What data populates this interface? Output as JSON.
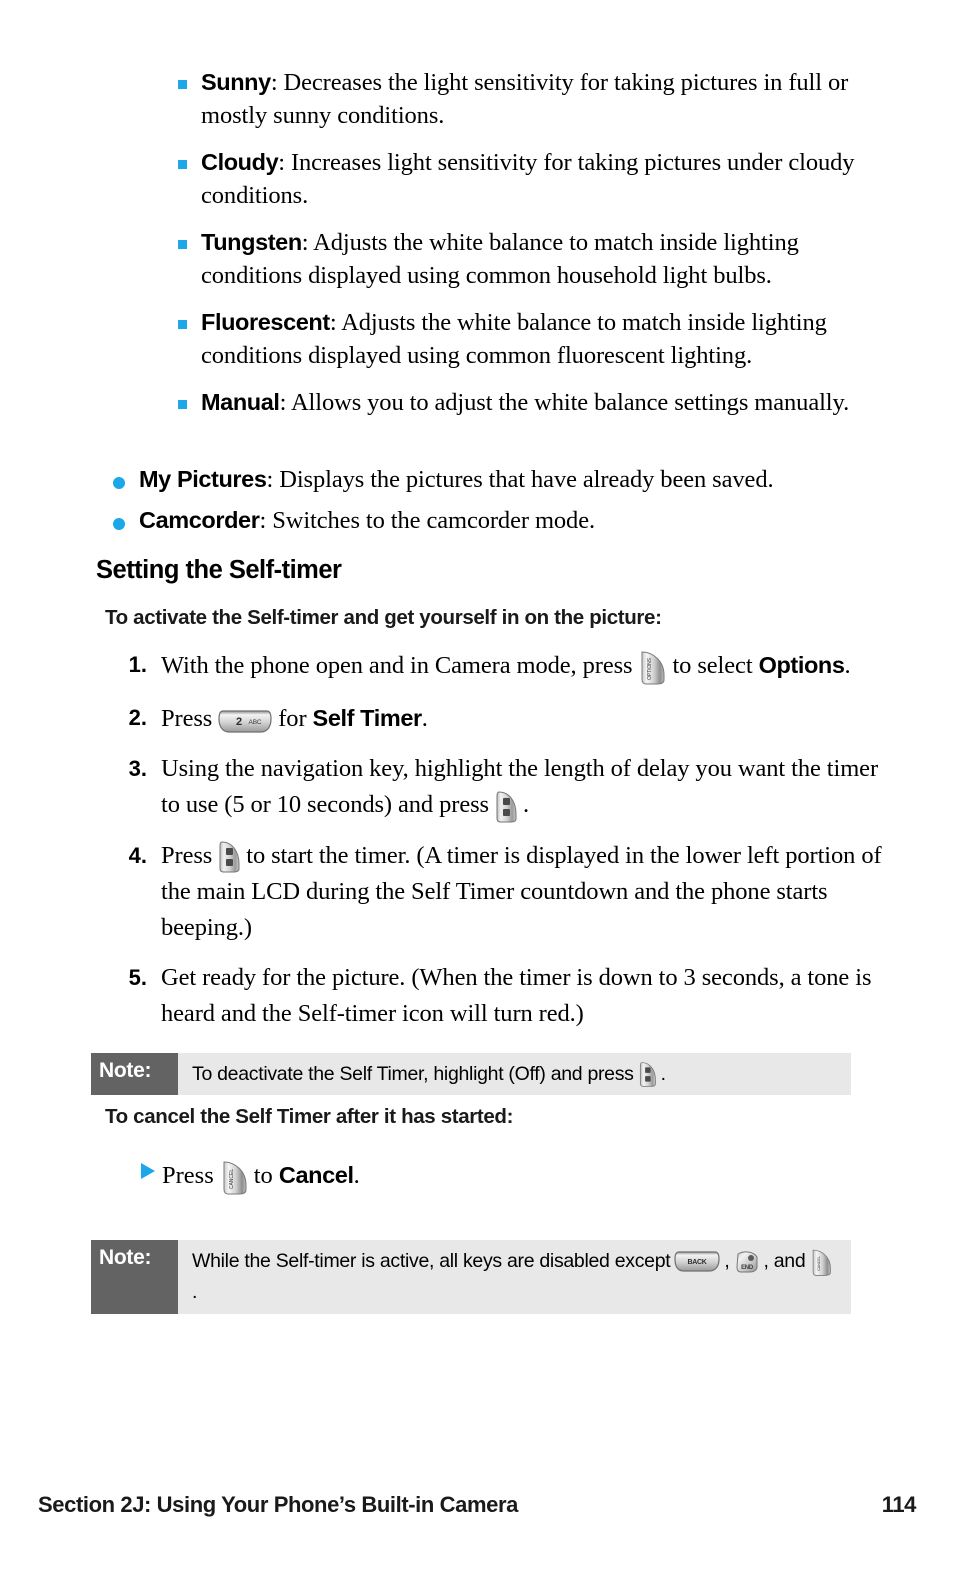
{
  "document": {
    "page_number": "114",
    "footer_section": "Section 2J: Using Your Phone’s Built-in Camera",
    "accent_color": "#1BA7E8",
    "note_label_bg": "#636363",
    "note_body_bg": "#e8e8e8"
  },
  "white_balance_options": [
    {
      "term": "Sunny",
      "description": ": Decreases the light sensitivity for taking pictures in full or mostly sunny conditions."
    },
    {
      "term": "Cloudy",
      "description": ": Increases light sensitivity for taking pictures under cloudy conditions."
    },
    {
      "term": "Tungsten",
      "description": ": Adjusts the white balance to match inside lighting conditions displayed using common household light bulbs."
    },
    {
      "term": "Fluorescent",
      "description": ": Adjusts the white balance to match inside lighting conditions displayed using common fluorescent lighting."
    },
    {
      "term": "Manual",
      "description": ": Allows you to adjust the white balance settings manually."
    }
  ],
  "menu_options": [
    {
      "term": "My Pictures",
      "description": ": Displays the pictures that have already been saved."
    },
    {
      "term": "Camcorder",
      "description": ": Switches to the camcorder mode."
    }
  ],
  "section": {
    "heading": "Setting the Self-timer",
    "subheading_activate": "To activate the Self-timer and get yourself in on the picture:",
    "subheading_cancel": "To cancel the Self Timer after it has started:"
  },
  "steps": [
    {
      "num": "1.",
      "part1": "With the phone open and in Camera mode, press",
      "key": "softkey-options",
      "key_label": "OPTIONS",
      "part2": "to select",
      "bold": "Options",
      "part3": "."
    },
    {
      "num": "2.",
      "part1": "Press",
      "key": "number-key-2",
      "key_label": "2",
      "key_sublabel": "ABC",
      "part2": "for",
      "bold": "Self Timer",
      "part3": "."
    },
    {
      "num": "3.",
      "part1": "Using the navigation key, highlight the length of delay you want the timer to use (5 or 10 seconds) and press",
      "key": "ok-key",
      "key_label": "OK",
      "part2": "",
      "bold": "",
      "part3": "."
    },
    {
      "num": "4.",
      "part1": "Press",
      "key": "ok-key",
      "key_label": "OK",
      "part2": "to start the timer. (A timer is displayed in the lower left portion of the main LCD during the Self Timer countdown and the phone starts beeping.)",
      "bold": "",
      "part3": ""
    },
    {
      "num": "5.",
      "part1": "Get ready for the picture. (When the timer is down to 3 seconds, a tone is heard and the Self-timer icon will turn red.)",
      "key": "",
      "key_label": "",
      "part2": "",
      "bold": "",
      "part3": ""
    }
  ],
  "cancel_item": {
    "part1": "Press",
    "key": "softkey-cancel",
    "key_label": "CANCEL",
    "part2": "to",
    "bold": "Cancel",
    "part3": "."
  },
  "notes": [
    {
      "label": "Note:",
      "text_before": "To deactivate the Self Timer, highlight (Off) and press",
      "key": "ok-key",
      "text_after": "."
    },
    {
      "label": "Note:",
      "text_before": "While the Self-timer is active, all keys are disabled except",
      "key1": "back-key",
      "key1_label": "BACK",
      "sep1": ",",
      "key2": "end-key",
      "key2_label": "END",
      "sep2": ",",
      "text_middle": "and",
      "key3": "softkey-cancel",
      "key3_label": "CANCEL",
      "text_after": "."
    }
  ]
}
